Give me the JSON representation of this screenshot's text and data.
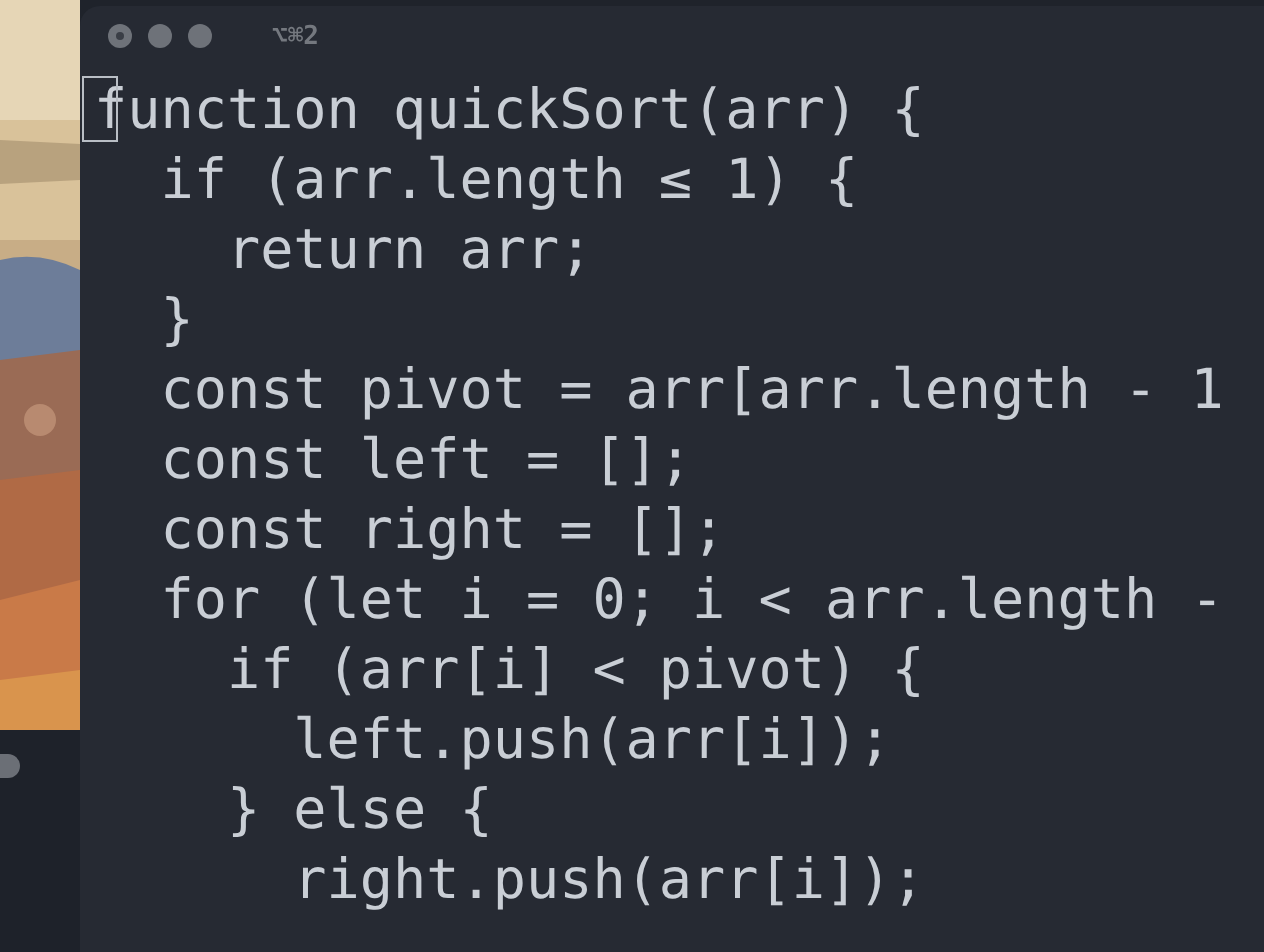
{
  "window": {
    "title": "⌥⌘2"
  },
  "code_lines": [
    "function quickSort(arr) {",
    "  if (arr.length ≤ 1) {",
    "    return arr;",
    "  }",
    "  const pivot = arr[arr.length - 1",
    "  const left = [];",
    "  const right = [];",
    "  for (let i = 0; i < arr.length -",
    "    if (arr[i] < pivot) {",
    "      left.push(arr[i]);",
    "    } else {",
    "      right.push(arr[i]);"
  ]
}
